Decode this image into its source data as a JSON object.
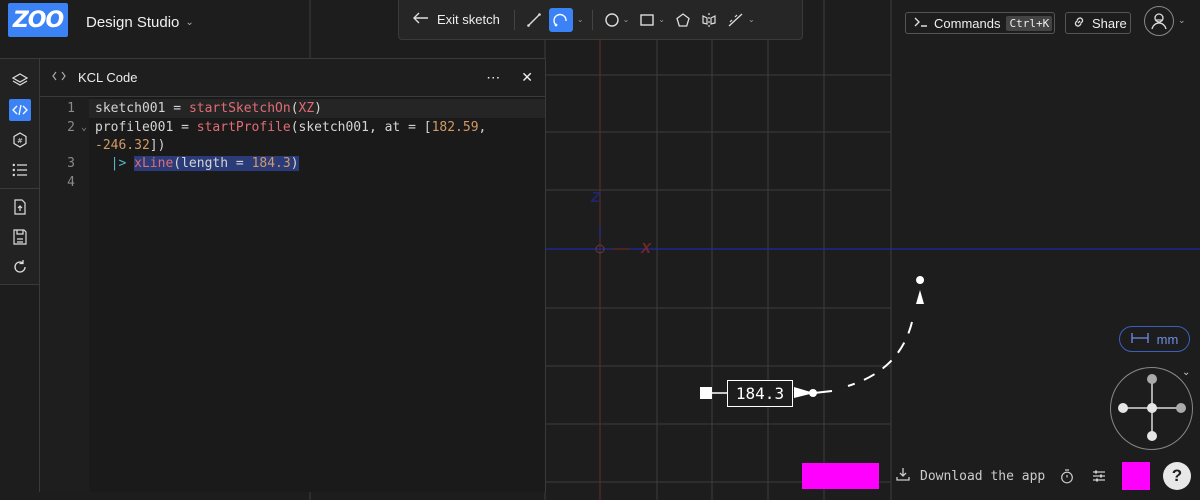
{
  "app": {
    "logo_text": "ZOO",
    "project_name": "Design Studio",
    "accent": "#3b82f6"
  },
  "toolbar": {
    "exit_label": "Exit sketch",
    "tools": [
      "line-icon",
      "tangent-arc-icon",
      "circle-icon",
      "rectangle-icon",
      "polygon-icon",
      "mirror-icon",
      "dimension-icon"
    ],
    "active_tool": "tangent-arc-icon"
  },
  "topbar": {
    "commands_label": "Commands",
    "commands_shortcut": "Ctrl+K",
    "share_label": "Share"
  },
  "sidebar": {
    "items": [
      "feature-tree-icon",
      "code-icon",
      "files-icon",
      "list-icon",
      "export-icon",
      "save-icon",
      "refresh-icon"
    ],
    "active": "code-icon"
  },
  "panel": {
    "title": "KCL Code",
    "line_numbers": [
      "1",
      "2",
      "3",
      "4"
    ],
    "code": {
      "l1_var": "sketch001",
      "l1_eq": " = ",
      "l1_fn": "startSketchOn",
      "l1_open": "(",
      "l1_arg": "XZ",
      "l1_close": ")",
      "l2_var": "profile001",
      "l2_eq": " = ",
      "l2_fn": "startProfile",
      "l2_args": "(sketch001, at = [",
      "l2_num1": "182.59",
      "l2_comma": ",",
      "l2_num2": "-246.32",
      "l2_end": "])",
      "l3_pipe": "|>",
      "l3_fn": "xLine",
      "l3_args": "(length = ",
      "l3_num": "184.3",
      "l3_end": ")"
    }
  },
  "canvas": {
    "dimension_value": "184.3",
    "units_label": "mm",
    "axis_x_label": "X",
    "axis_z_label": "Z"
  },
  "bottombar": {
    "download_label": "Download the app",
    "help_label": "?"
  },
  "colors": {
    "placeholder": "#ff00ff",
    "x_axis": "#c0392b",
    "y_axis": "#1f2aa8"
  }
}
